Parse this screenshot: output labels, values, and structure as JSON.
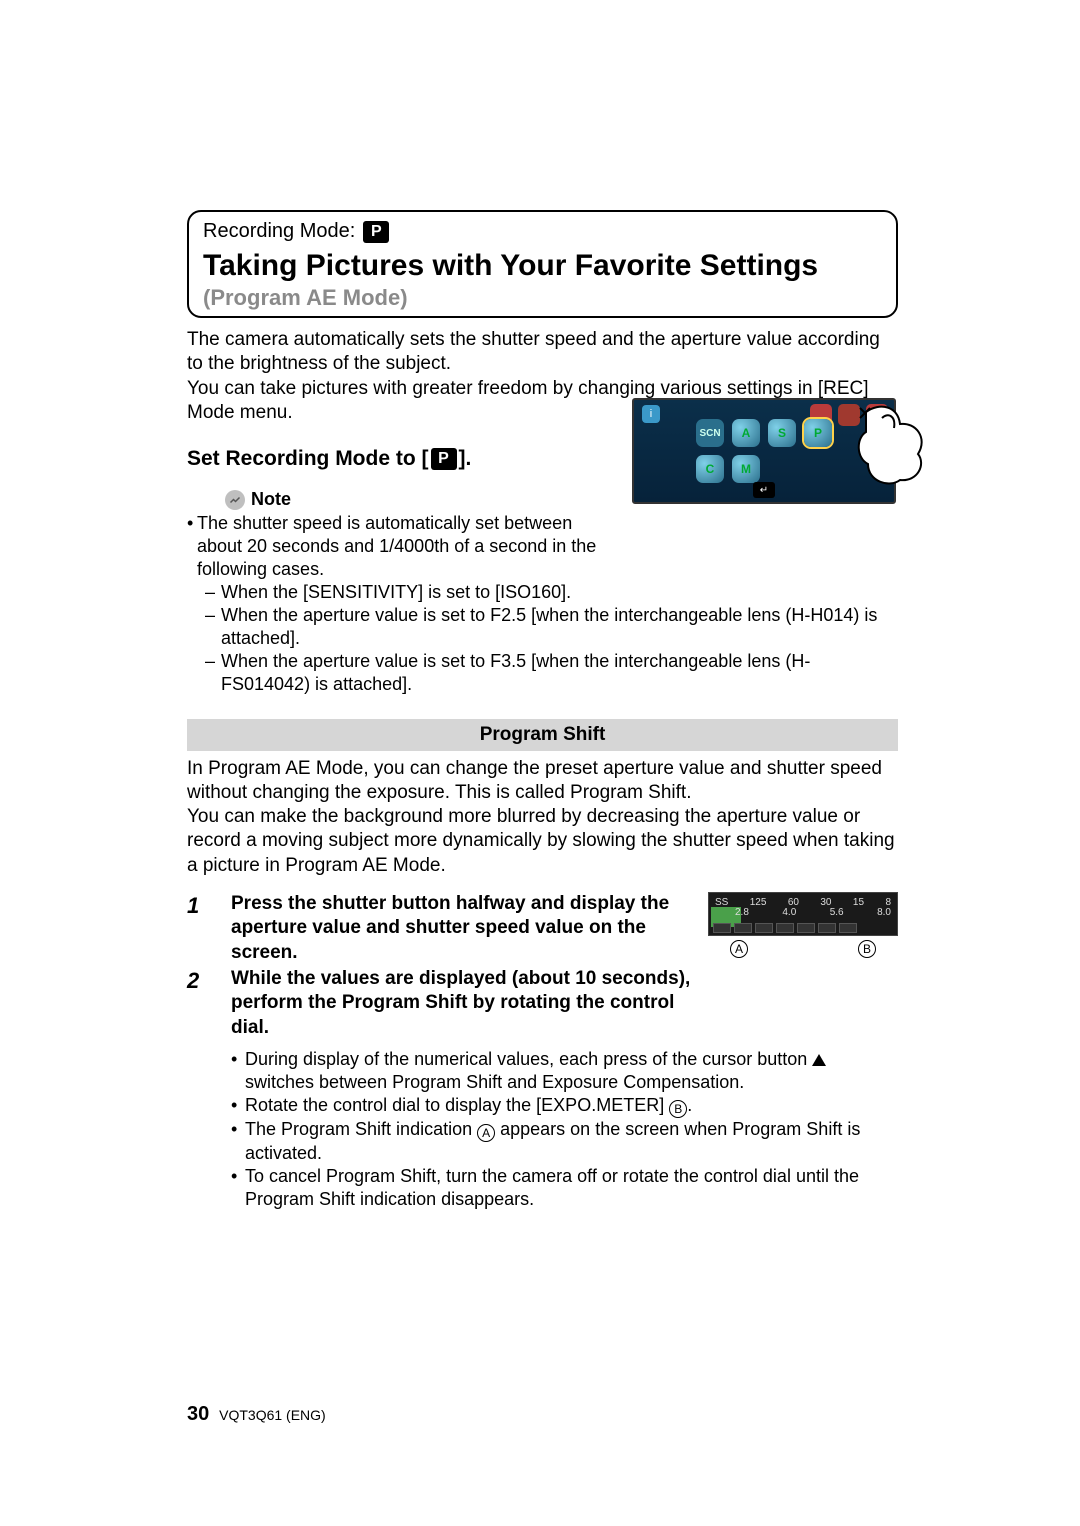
{
  "header": {
    "recording_mode_label": "Recording Mode:",
    "title_main": "Taking Pictures with Your Favorite Settings",
    "title_sub": "(Program AE Mode)"
  },
  "intro": {
    "p1": "The camera automatically sets the shutter speed and the aperture value according to the brightness of the subject.",
    "p2": "You can take pictures with greater freedom by changing various settings in [REC] Mode menu."
  },
  "set_line": {
    "pre": "Set Recording Mode to [",
    "post": "]."
  },
  "note": {
    "label": "Note",
    "b1": "The shutter speed is automatically set between about 20 seconds and 1/4000th of a second in the following cases.",
    "s1": "When the [SENSITIVITY] is set to [ISO160].",
    "s2": "When the aperture value is set to F2.5 [when the interchangeable lens (H-H014) is attached].",
    "s3": "When the aperture value is set to F3.5 [when the interchangeable lens (H-FS014042) is attached]."
  },
  "program_shift": {
    "heading": "Program Shift",
    "p1": "In Program AE Mode, you can change the preset aperture value and shutter speed without changing the exposure. This is called Program Shift.",
    "p2": "You can make the background more blurred by decreasing the aperture value or record a moving subject more dynamically by slowing the shutter speed when taking a picture in Program AE Mode."
  },
  "steps": {
    "n1": "1",
    "t1": "Press the shutter button halfway and display the aperture value and shutter speed value on the screen.",
    "n2": "2",
    "t2": "While the values are displayed (about 10 seconds), perform the Program Shift by rotating the control dial."
  },
  "sub": {
    "b1a": "During display of the numerical values, each press of the cursor button ",
    "b1b": " switches between Program Shift and Exposure Compensation.",
    "b2a": "Rotate the control dial to display the [EXPO.METER] ",
    "b2b": ".",
    "b3a": "The Program Shift indication ",
    "b3b": " appears on the screen when Program Shift is activated.",
    "b4": "To cancel Program Shift, turn the camera off or rotate the control dial until the Program Shift indication disappears."
  },
  "expo": {
    "top": [
      "SS",
      "125",
      "60",
      "30",
      "15",
      "8"
    ],
    "bot": [
      "2.8",
      "4.0",
      "5.6",
      "8.0"
    ],
    "labelA": "A",
    "labelB": "B"
  },
  "mode_icons": {
    "scn": "SCN",
    "p": "P",
    "a": "A",
    "s": "S",
    "m": "M",
    "c": "C",
    "ret": "↵",
    "i": "i"
  },
  "footer": {
    "page": "30",
    "code": "VQT3Q61 (ENG)"
  }
}
